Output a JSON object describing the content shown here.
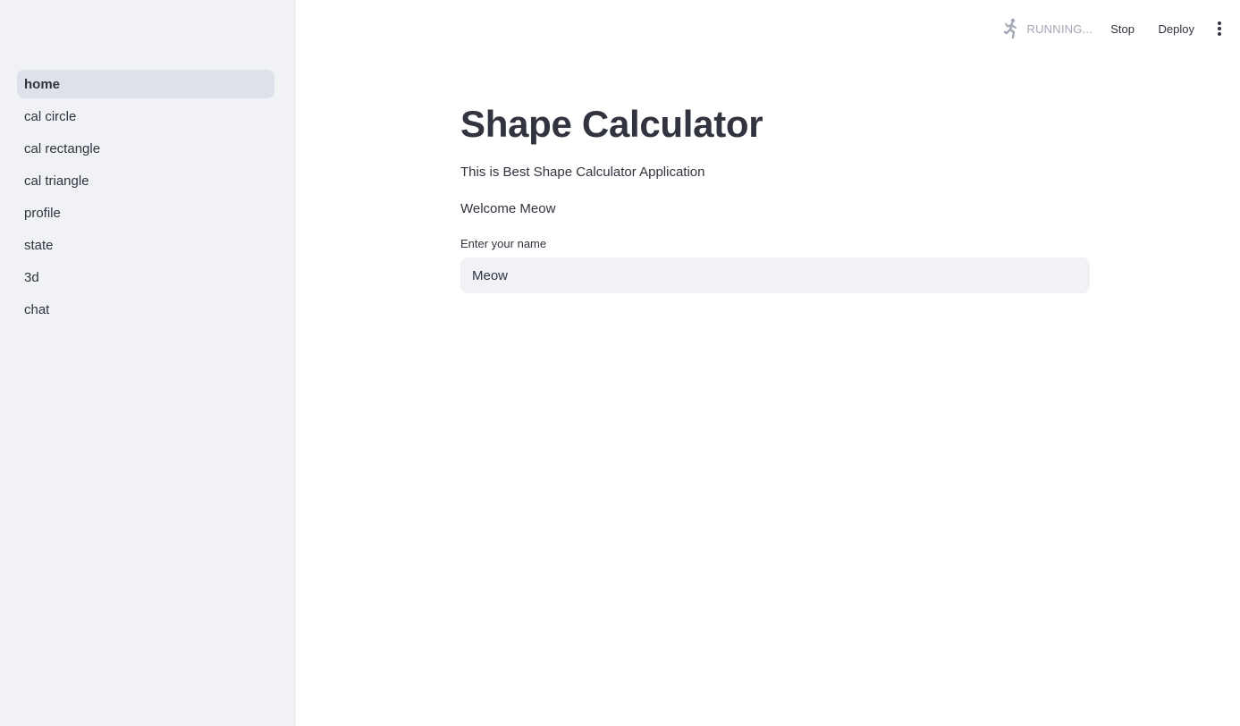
{
  "sidebar": {
    "items": [
      {
        "label": "home",
        "active": true
      },
      {
        "label": "cal circle",
        "active": false
      },
      {
        "label": "cal rectangle",
        "active": false
      },
      {
        "label": "cal triangle",
        "active": false
      },
      {
        "label": "profile",
        "active": false
      },
      {
        "label": "state",
        "active": false
      },
      {
        "label": "3d",
        "active": false
      },
      {
        "label": "chat",
        "active": false
      }
    ]
  },
  "header": {
    "status_text": "RUNNING...",
    "status_icon": "running-man-icon",
    "stop_label": "Stop",
    "deploy_label": "Deploy",
    "menu_icon": "vertical-dots-icon"
  },
  "main": {
    "title": "Shape Calculator",
    "description": "This is Best Shape Calculator Application",
    "welcome": "Welcome Meow",
    "name_label": "Enter your name",
    "name_value": "Meow"
  },
  "colors": {
    "sidebar_bg": "#f0f2f6",
    "active_item_bg": "#dde1ea",
    "text": "#31333f",
    "muted": "#a3a8b4",
    "input_bg": "#f0f2f6"
  }
}
